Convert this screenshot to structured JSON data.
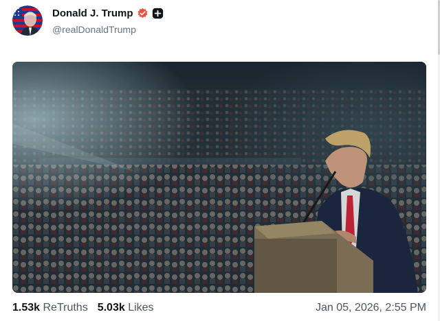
{
  "author": {
    "display_name": "Donald J. Trump",
    "handle": "@realDonaldTrump",
    "verified_icon": "verified-badge-icon",
    "plus_icon": "plus-badge-icon",
    "avatar_icon": "flag-portrait-avatar"
  },
  "media": {
    "type": "video-still",
    "description_icon": "rally-speech-image"
  },
  "stats": {
    "retruths_count": "1.53k",
    "retruths_label": "ReTruths",
    "likes_count": "5.03k",
    "likes_label": "Likes"
  },
  "timestamp": "Jan 05, 2026, 2:55 PM",
  "colors": {
    "verified": "#f0513a",
    "text_primary": "#0f1419",
    "text_secondary": "#4b5563"
  }
}
